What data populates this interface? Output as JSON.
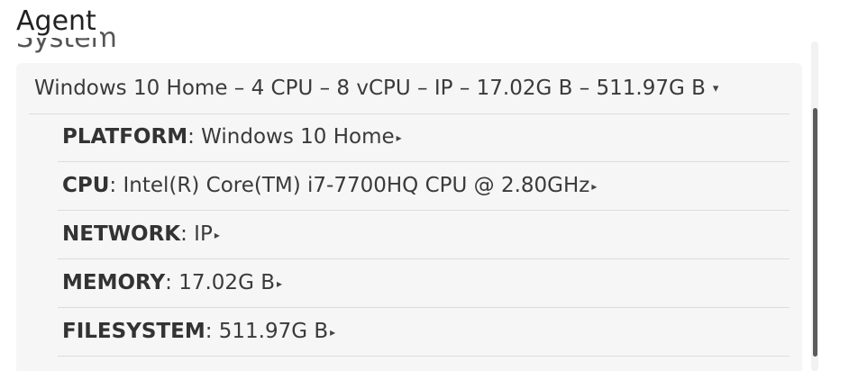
{
  "header": {
    "title": "Agent",
    "section_title": "System"
  },
  "summary": {
    "text": "Windows 10 Home – 4 CPU – 8 vCPU – IP – 17.02G B – 511.97G B",
    "caret": "▾"
  },
  "details": [
    {
      "label": "PLATFORM",
      "separator": ":",
      "value": "Windows 10 Home",
      "caret": "▸"
    },
    {
      "label": "CPU",
      "separator": ":",
      "value": "Intel(R) Core(TM) i7-7700HQ CPU @ 2.80GHz",
      "caret": "▸"
    },
    {
      "label": "NETWORK",
      "separator": ":",
      "value": "IP",
      "caret": "▸"
    },
    {
      "label": "MEMORY",
      "separator": ":",
      "value": "17.02G B",
      "caret": "▸"
    },
    {
      "label": "FILESYSTEM",
      "separator": ":",
      "value": "511.97G B",
      "caret": "▸"
    }
  ]
}
